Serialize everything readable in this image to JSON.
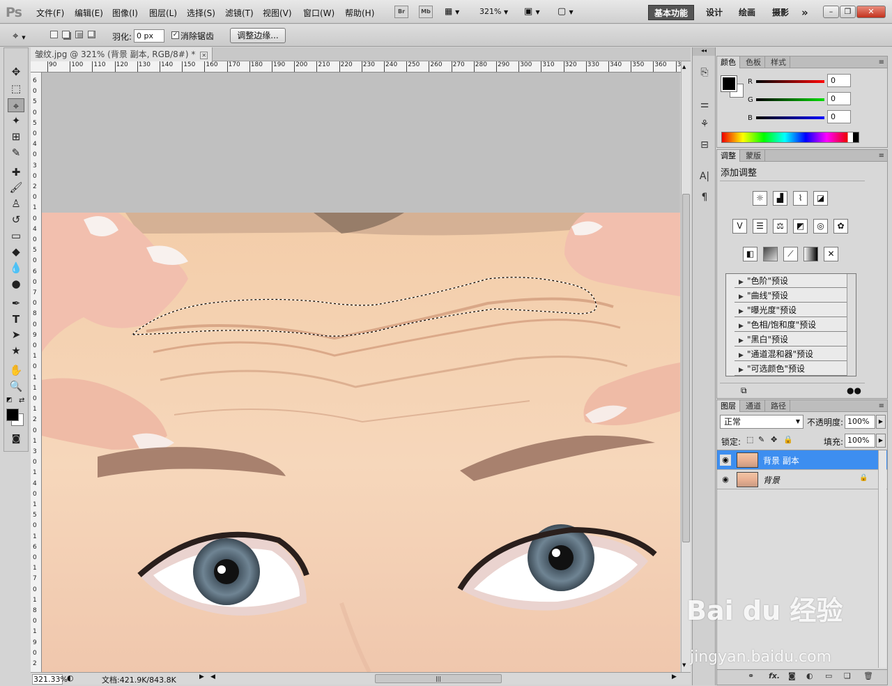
{
  "app": {
    "logo": "Ps"
  },
  "menu": [
    "文件(F)",
    "编辑(E)",
    "图像(I)",
    "图层(L)",
    "选择(S)",
    "滤镜(T)",
    "视图(V)",
    "窗口(W)",
    "帮助(H)"
  ],
  "menubar_buttons": {
    "bridge": "Br",
    "minibridge": "Mb",
    "zoom": "321%"
  },
  "workspaces": {
    "active": "基本功能",
    "items": [
      "设计",
      "绘画",
      "摄影"
    ],
    "more": "»"
  },
  "window_buttons": {
    "minimize": "–",
    "restore": "❐",
    "close": "✕"
  },
  "options": {
    "feather_label": "羽化:",
    "feather_value": "0 px",
    "antialias_label": "消除锯齿",
    "refine_edge": "调整边缘..."
  },
  "document": {
    "tab_title": "皱纹.jpg @ 321% (背景 副本, RGB/8#) *",
    "zoom_status": "321.33%",
    "doc_info": "文档:421.9K/843.8K"
  },
  "ruler_top": [
    "90",
    "100",
    "110",
    "120",
    "130",
    "140",
    "150",
    "160",
    "170",
    "180",
    "190",
    "200",
    "210",
    "220",
    "230",
    "240",
    "250",
    "260",
    "270",
    "280",
    "290",
    "300",
    "310",
    "320",
    "330",
    "340",
    "350",
    "360",
    "3"
  ],
  "ruler_left": [
    "6",
    "0",
    "5",
    "0",
    "5",
    "0",
    "4",
    "0",
    "3",
    "0",
    "2",
    "0",
    "1",
    "0",
    "4",
    "0",
    "5",
    "0",
    "6",
    "0",
    "7",
    "0",
    "8",
    "0",
    "9",
    "0",
    "1",
    "0",
    "1",
    "1",
    "0",
    "1",
    "2",
    "0",
    "1",
    "3",
    "0",
    "1",
    "4",
    "0",
    "1",
    "5",
    "0",
    "1",
    "6",
    "0",
    "1",
    "7",
    "0",
    "1",
    "8",
    "0",
    "1",
    "9",
    "0",
    "2"
  ],
  "color_panel": {
    "tabs": [
      "颜色",
      "色板",
      "样式"
    ],
    "channels": [
      {
        "label": "R",
        "value": "0",
        "color": "#ff0000"
      },
      {
        "label": "G",
        "value": "0",
        "color": "#00d000"
      },
      {
        "label": "B",
        "value": "0",
        "color": "#0000ff"
      }
    ]
  },
  "adjust_panel": {
    "tabs": [
      "调整",
      "蒙版"
    ],
    "title": "添加调整",
    "presets": [
      "\"色阶\"预设",
      "\"曲线\"预设",
      "\"曝光度\"预设",
      "\"色相/饱和度\"预设",
      "\"黑白\"预设",
      "\"通道混和器\"预设",
      "\"可选颜色\"预设"
    ]
  },
  "layers_panel": {
    "tabs": [
      "图层",
      "通道",
      "路径"
    ],
    "blend_mode": "正常",
    "opacity_label": "不透明度:",
    "opacity": "100%",
    "lock_label": "锁定:",
    "fill_label": "填充:",
    "fill": "100%",
    "layers": [
      {
        "name": "背景 副本",
        "selected": true
      },
      {
        "name": "背景",
        "selected": false
      }
    ]
  },
  "watermark": {
    "brand": "Bai du 经验",
    "url": "jingyan.baidu.com"
  }
}
